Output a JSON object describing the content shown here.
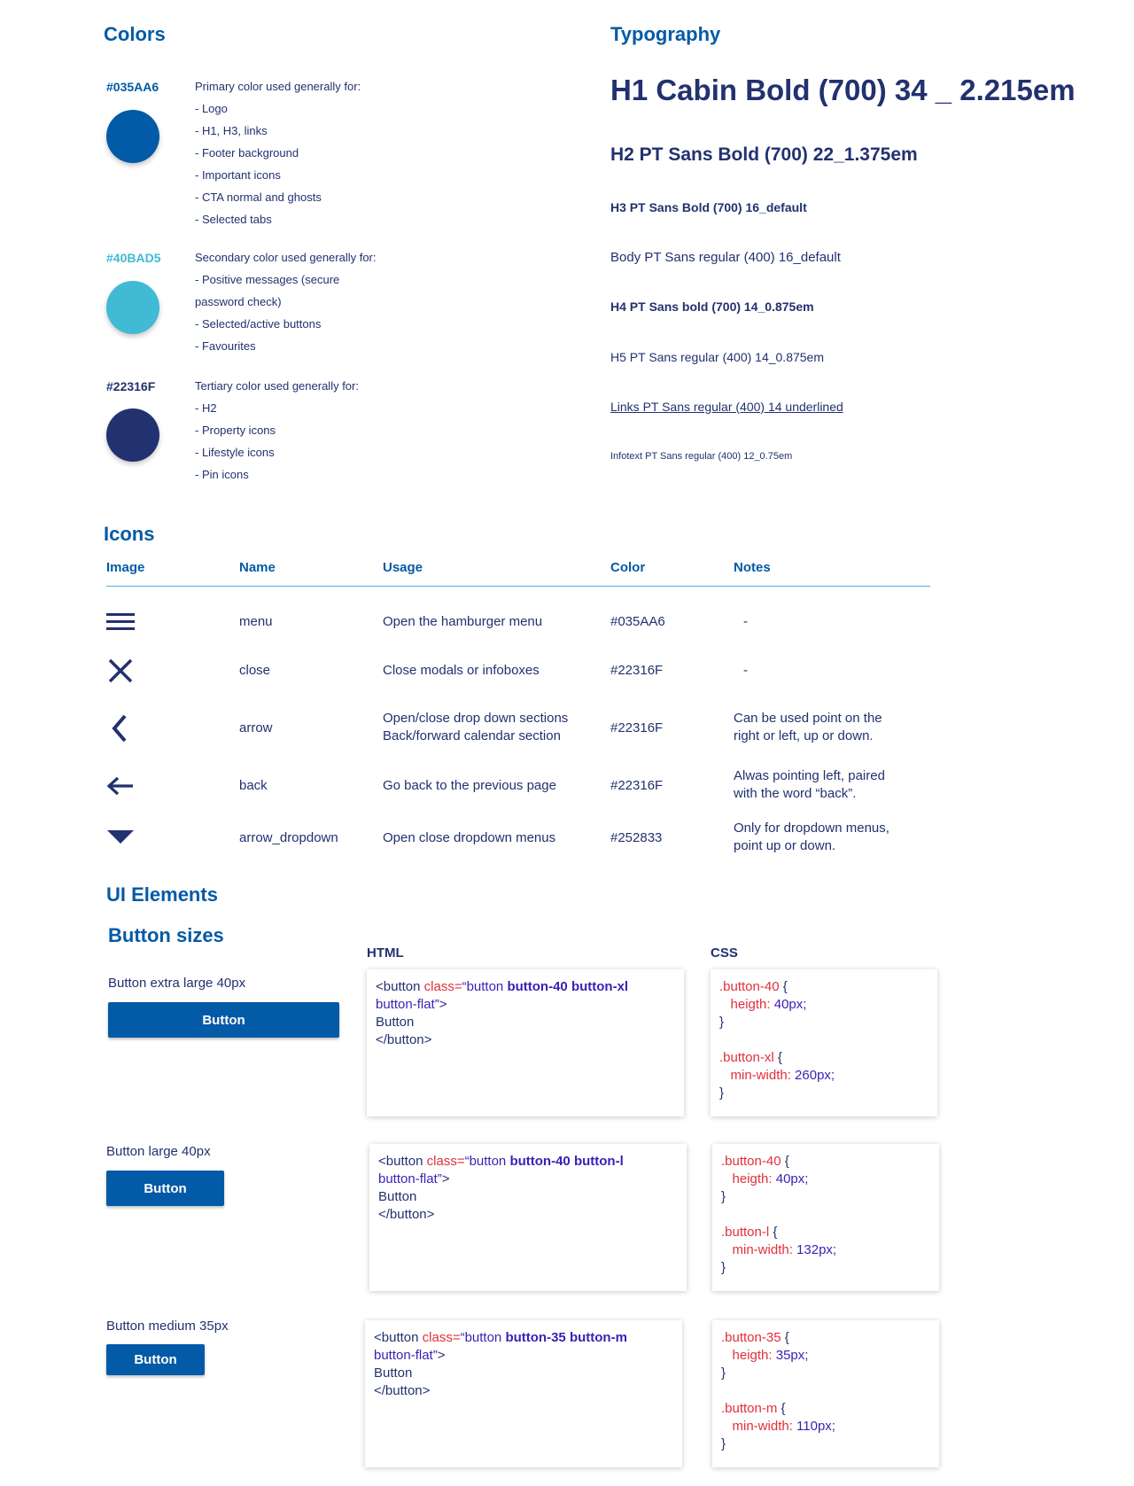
{
  "colors": {
    "title": "Colors",
    "items": [
      {
        "hex": "#035AA6",
        "label_color": "#035AA6",
        "swatch": "#035AA6",
        "lines": [
          "Primary color used generally for:",
          "- Logo",
          "- H1, H3, links",
          "- Footer background",
          "- Important icons",
          "- CTA normal and ghosts",
          "- Selected tabs"
        ]
      },
      {
        "hex": "#40BAD5",
        "label_color": "#40BAD5",
        "swatch": "#40BAD5",
        "lines": [
          "Secondary color used generally for:",
          "- Positive messages (secure",
          "password check)",
          "- Selected/active buttons",
          "- Favourites"
        ]
      },
      {
        "hex": "#22316F",
        "label_color": "#22316F",
        "swatch": "#22316F",
        "lines": [
          "Tertiary color used generally for:",
          "- H2",
          "- Property icons",
          "- Lifestyle icons",
          "- Pin icons"
        ]
      }
    ]
  },
  "typography": {
    "title": "Typography",
    "h1": "H1 Cabin Bold (700) 34 _ 2.215em",
    "h2": "H2 PT Sans Bold (700) 22_1.375em",
    "h3": "H3 PT Sans Bold  (700) 16_default",
    "body": "Body PT Sans regular (400) 16_default",
    "h4": "H4 PT Sans bold (700) 14_0.875em",
    "h5": "H5 PT Sans regular (400) 14_0.875em",
    "links": "Links PT Sans regular (400) 14 underlined",
    "infotext": "Infotext PT Sans regular (400) 12_0.75em"
  },
  "icons": {
    "title": "Icons",
    "headers": {
      "image": "Image",
      "name": "Name",
      "usage": "Usage",
      "color": "Color",
      "notes": "Notes"
    },
    "rows": [
      {
        "icon": "menu-icon",
        "name": "menu",
        "usage1": "Open the hamburger menu",
        "usage2": "",
        "color": "#035AA6",
        "note1": "-",
        "note2": ""
      },
      {
        "icon": "close-icon",
        "name": "close",
        "usage1": "Close modals or infoboxes",
        "usage2": "",
        "color": "#22316F",
        "note1": "-",
        "note2": ""
      },
      {
        "icon": "arrow-icon",
        "name": "arrow",
        "usage1": "Open/close drop down sections",
        "usage2": "Back/forward calendar section",
        "color": "#22316F",
        "note1": "Can be used point on the",
        "note2": "right or left, up or down."
      },
      {
        "icon": "back-arrow-icon",
        "name": "back",
        "usage1": "Go back to the previous page",
        "usage2": "",
        "color": "#22316F",
        "note1": "Alwas pointing left, paired",
        "note2": "with the word “back”."
      },
      {
        "icon": "dropdown-triangle-icon",
        "name": "arrow_dropdown",
        "usage1": "Open close dropdown menus",
        "usage2": "",
        "color": "#252833",
        "note1": "Only for dropdown menus,",
        "note2": "point up or down."
      }
    ]
  },
  "ui": {
    "title": "UI Elements",
    "button_sizes_title": "Button sizes",
    "html_header": "HTML",
    "css_header": "CSS",
    "buttons": [
      {
        "label": "Button extra large 40px",
        "button_text": "Button",
        "html": {
          "open": "<button ",
          "class_attr": "class=",
          "quote_open": "“button ",
          "class_names": "button-40 button-xl",
          "line2_class": "button-flat",
          "quote_close": "”",
          "gt": ">",
          "text": "Button",
          "close": "</button>"
        },
        "css": {
          "sel1": ".button-40",
          "prop1": "heigth:",
          "val1": "40px;",
          "sel2": ".button-xl",
          "prop2": "min-width:",
          "val2": "260px;"
        }
      },
      {
        "label": "Button large 40px",
        "button_text": "Button",
        "html": {
          "open": "<button ",
          "class_attr": "class=",
          "quote_open": "“button ",
          "class_names": "button-40 button-l",
          "line2_class": "button-flat",
          "quote_close": "”",
          "gt": ">",
          "text": "Button",
          "close": "</button>"
        },
        "css": {
          "sel1": ".button-40",
          "prop1": "heigth:",
          "val1": "40px;",
          "sel2": ".button-l",
          "prop2": "min-width:",
          "val2": "132px;"
        }
      },
      {
        "label": "Button medium 35px",
        "button_text": "Button",
        "html": {
          "open": "<button ",
          "class_attr": "class=",
          "quote_open": "“button ",
          "class_names": "button-35 button-m",
          "line2_class": "button-flat",
          "quote_close": "”",
          "gt": ">",
          "text": "Button",
          "close": "</button>"
        },
        "css": {
          "sel1": ".button-35",
          "prop1": "heigth:",
          "val1": "35px;",
          "sel2": ".button-m",
          "prop2": "min-width:",
          "val2": "110px;"
        }
      }
    ],
    "brace_open": "{",
    "brace_close": "}"
  }
}
